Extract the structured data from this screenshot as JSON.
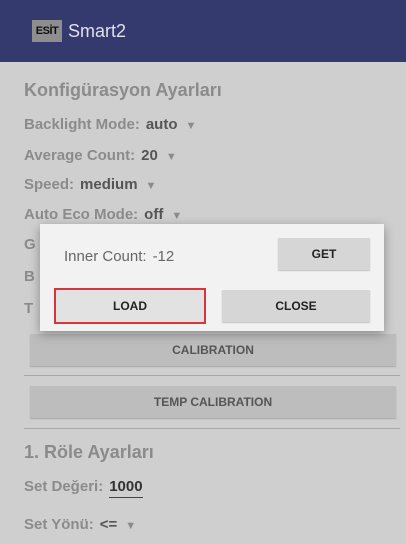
{
  "appbar": {
    "logo_text": "ESİT",
    "title": "Smart2"
  },
  "config": {
    "title": "Konfigürasyon Ayarları",
    "backlight": {
      "label": "Backlight Mode:",
      "value": "auto"
    },
    "average": {
      "label": "Average Count:",
      "value": "20"
    },
    "speed": {
      "label": "Speed:",
      "value": "medium"
    },
    "eco": {
      "label": "Auto Eco Mode:",
      "value": "off"
    },
    "hidden_row_1": "G",
    "hidden_row_2": "B",
    "hidden_row_3": "T"
  },
  "buttons": {
    "calibration": "CALIBRATION",
    "temp_calibration": "TEMP CALIBRATION"
  },
  "relay": {
    "title": "1. Röle Ayarları",
    "set_value": {
      "label": "Set Değeri:",
      "value": "1000"
    },
    "set_direction": {
      "label": "Set Yönü:",
      "value": "<="
    }
  },
  "dialog": {
    "inner_label": "Inner Count:",
    "inner_value": "-12",
    "get": "GET",
    "load": "LOAD",
    "close": "CLOSE"
  },
  "icons": {
    "dropdown": "caret-down-icon"
  }
}
